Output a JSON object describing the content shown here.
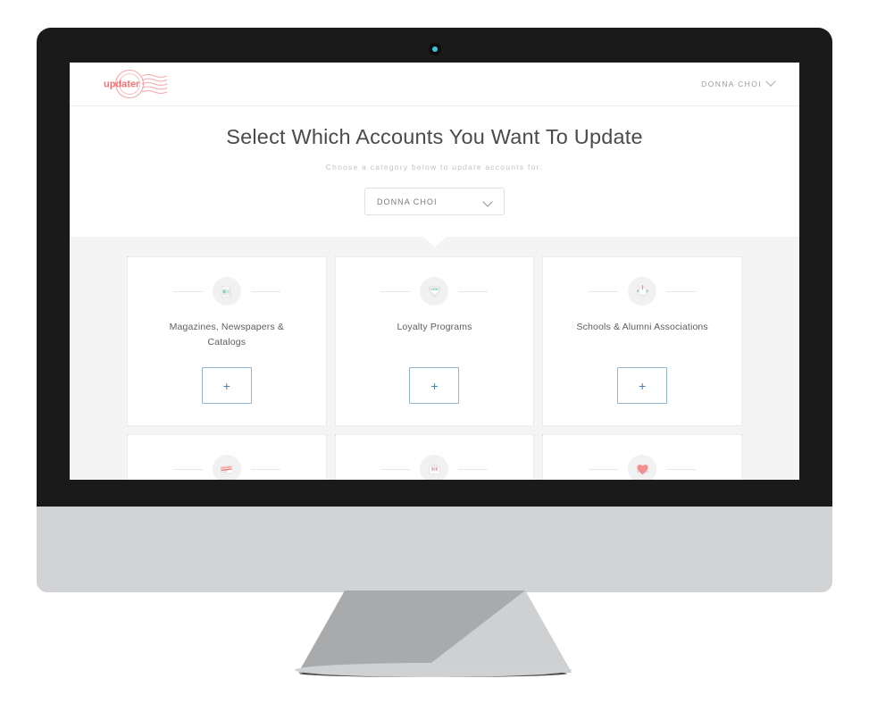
{
  "device": {
    "type": "desktop-monitor",
    "bezel_color": "#1a1a1a",
    "chin_color": "#d2d3d5",
    "webcam_color": "#3fc3e4"
  },
  "topbar": {
    "logo_text": "updater",
    "logo_color": "#f98a8a",
    "user_name": "DONNA CHOI",
    "chevron": "chevron-down"
  },
  "hero": {
    "title": "Select Which Accounts You Want To Update",
    "subtitle": "Choose a category below to update accounts for:",
    "category_select": {
      "value": "DONNA CHOI",
      "options": [
        "DONNA CHOI"
      ]
    }
  },
  "content": {
    "background_color": "#f4f4f4",
    "cards": [
      {
        "icon": "newspaper-icon",
        "title": "Magazines, Newspapers & Catalogs",
        "add_label": "+"
      },
      {
        "icon": "trophy-icon",
        "title": "Loyalty Programs",
        "add_label": "+"
      },
      {
        "icon": "graduation-bell-icon",
        "title": "Schools & Alumni Associations",
        "add_label": "+"
      }
    ],
    "cards_partial": [
      {
        "icon": "credit-card-icon"
      },
      {
        "icon": "briefcase-icon"
      },
      {
        "icon": "heart-icon"
      }
    ]
  },
  "colors": {
    "accent_red": "#f98a8a",
    "button_blue": "#4a82ad",
    "button_border_blue": "#8fb7d4",
    "text_primary": "#4b4b4b",
    "text_secondary": "#5d5d5d",
    "text_muted": "#c3c3c3"
  }
}
